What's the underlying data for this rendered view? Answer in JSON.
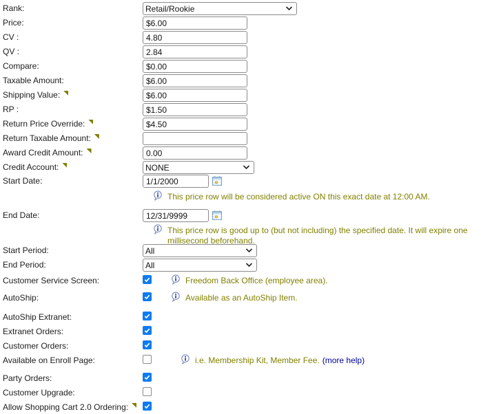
{
  "colors": {
    "checkbox_accent": "#0d7bf2",
    "info_text": "#808000",
    "link_text": "#000099",
    "marker": "#808000",
    "input_border": "#8a8a8a"
  },
  "fields": {
    "rank": {
      "label": "Rank:",
      "value": "Retail/Rookie"
    },
    "price": {
      "label": "Price:",
      "value": "$6.00"
    },
    "cv": {
      "label": "CV :",
      "value": "4.80"
    },
    "qv": {
      "label": "QV :",
      "value": "2.84"
    },
    "compare": {
      "label": "Compare:",
      "value": "$0.00"
    },
    "taxable_amount": {
      "label": "Taxable Amount:",
      "value": "$6.00"
    },
    "shipping_value": {
      "label": "Shipping Value:",
      "value": "$6.00",
      "marker": true
    },
    "rp": {
      "label": "RP :",
      "value": "$1.50"
    },
    "return_price_override": {
      "label": "Return Price Override:",
      "value": "$4.50",
      "marker": true
    },
    "return_taxable_amount": {
      "label": "Return Taxable Amount:",
      "value": "",
      "marker": true
    },
    "award_credit_amount": {
      "label": "Award Credit Amount:",
      "value": "0.00",
      "marker": true
    },
    "credit_account": {
      "label": "Credit Account:",
      "value": "NONE",
      "marker": true
    },
    "start_date": {
      "label": "Start Date:",
      "value": "1/1/2000",
      "info": "This price row will be considered active ON this exact date at 12:00 AM."
    },
    "end_date": {
      "label": "End Date:",
      "value": "12/31/9999",
      "info": "This price row is good up to (but not including) the specified date. It will expire one millisecond beforehand."
    },
    "start_period": {
      "label": "Start Period:",
      "value": "All"
    },
    "end_period": {
      "label": "End Period:",
      "value": "All"
    },
    "customer_service_screen": {
      "label": "Customer Service Screen:",
      "checked": true,
      "info": "Freedom Back Office (employee area)."
    },
    "autoship": {
      "label": "AutoShip:",
      "checked": true,
      "info": "Available as an AutoShip Item."
    },
    "autoship_extranet": {
      "label": "AutoShip Extranet:",
      "checked": true
    },
    "extranet_orders": {
      "label": "Extranet Orders:",
      "checked": true
    },
    "customer_orders": {
      "label": "Customer Orders:",
      "checked": true
    },
    "available_on_enroll_page": {
      "label": "Available on Enroll Page:",
      "checked": false,
      "info": "i.e. Membership Kit, Member Fee.",
      "link": "(more help)"
    },
    "party_orders": {
      "label": "Party Orders:",
      "checked": true
    },
    "customer_upgrade": {
      "label": "Customer Upgrade:",
      "checked": false
    },
    "allow_shopping_cart_20": {
      "label": "Allow Shopping Cart 2.0 Ordering:",
      "checked": true,
      "marker": true
    }
  }
}
